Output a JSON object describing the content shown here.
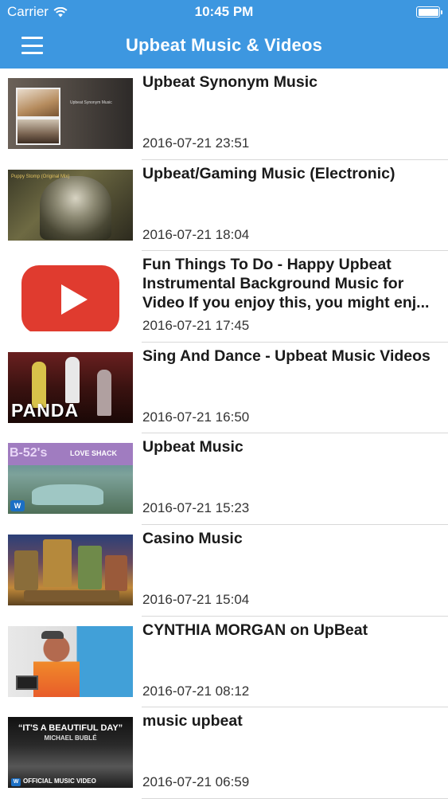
{
  "status_bar": {
    "carrier": "Carrier",
    "time": "10:45 PM",
    "wifi_icon": "wifi-icon",
    "battery_icon": "battery-icon"
  },
  "nav": {
    "title": "Upbeat Music & Videos",
    "menu_icon": "hamburger-menu-icon",
    "accent_color": "#3d97e0"
  },
  "videos": [
    {
      "title": "Upbeat Synonym Music",
      "date": "2016-07-21 23:51",
      "thumb_text": "Upbeat Synonym Music"
    },
    {
      "title": "Upbeat/Gaming Music (Electronic)",
      "date": "2016-07-21 18:04",
      "thumb_text": "Puppy Stomp (Original Mix)"
    },
    {
      "title": "Fun Things To Do - Happy Upbeat Instrumental Background Music for Video If you enjoy this, you might enj...",
      "date": "2016-07-21 17:45",
      "thumb_text": ""
    },
    {
      "title": "Sing And Dance - Upbeat Music Videos",
      "date": "2016-07-21 16:50",
      "thumb_text": "PANDA"
    },
    {
      "title": "Upbeat Music",
      "date": "2016-07-21 15:23",
      "thumb_text": "LOVE SHACK",
      "thumb_band": "B-52's"
    },
    {
      "title": "Casino Music",
      "date": "2016-07-21 15:04",
      "thumb_text": ""
    },
    {
      "title": "CYNTHIA MORGAN on UpBeat",
      "date": "2016-07-21 08:12",
      "thumb_text": ""
    },
    {
      "title": "music upbeat",
      "date": "2016-07-21 06:59",
      "thumb_text": "“IT'S A BEAUTIFUL DAY”",
      "thumb_artist": "MICHAEL BUBLÉ",
      "thumb_caption": "OFFICIAL MUSIC VIDEO"
    }
  ]
}
